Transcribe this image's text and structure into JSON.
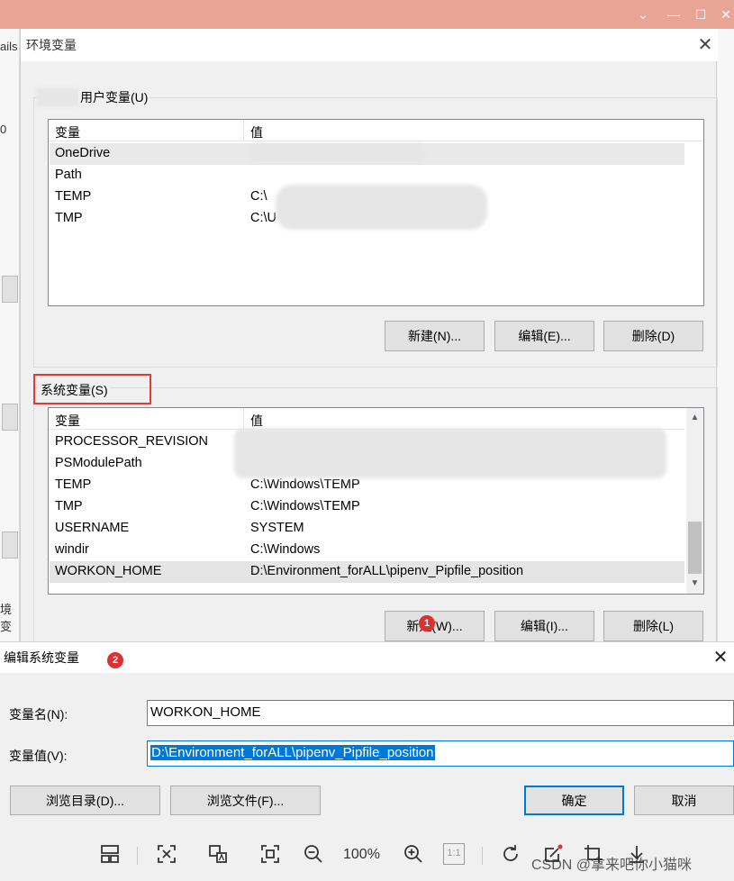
{
  "background_window": {
    "left_strip_texts": [
      "ails",
      "0",
      "境变"
    ]
  },
  "env_dialog": {
    "title": "环境变量",
    "user_group": {
      "label": "用户变量(U)",
      "headers": [
        "变量",
        "值"
      ],
      "rows": [
        {
          "name": "OneDrive",
          "value": ""
        },
        {
          "name": "Path",
          "value": ""
        },
        {
          "name": "TEMP",
          "value": "C:\\"
        },
        {
          "name": "TMP",
          "value": "C:\\U"
        }
      ],
      "buttons": [
        "新建(N)...",
        "编辑(E)...",
        "删除(D)"
      ]
    },
    "system_group": {
      "label": "系统变量(S)",
      "headers": [
        "变量",
        "值"
      ],
      "rows": [
        {
          "name": "PROCESSOR_REVISION",
          "value": ""
        },
        {
          "name": "PSModulePath",
          "value": ""
        },
        {
          "name": "TEMP",
          "value": "C:\\Windows\\TEMP"
        },
        {
          "name": "TMP",
          "value": "C:\\Windows\\TEMP"
        },
        {
          "name": "USERNAME",
          "value": "SYSTEM"
        },
        {
          "name": "windir",
          "value": "C:\\Windows"
        },
        {
          "name": "WORKON_HOME",
          "value": "D:\\Environment_forALL\\pipenv_Pipfile_position"
        }
      ],
      "buttons": [
        "新建(W)...",
        "编辑(I)...",
        "删除(L)"
      ]
    }
  },
  "edit_dialog": {
    "title": "编辑系统变量",
    "name_label": "变量名(N):",
    "name_value": "WORKON_HOME",
    "value_label": "变量值(V):",
    "value_value": "D:\\Environment_forALL\\pipenv_Pipfile_position",
    "buttons": {
      "browse_dir": "浏览目录(D)...",
      "browse_file": "浏览文件(F)...",
      "ok": "确定",
      "cancel": "取消"
    }
  },
  "annotations": {
    "badge1": "1",
    "badge2": "2"
  },
  "viewer_toolbar": {
    "zoom": "100%",
    "ratio_label": "1:1",
    "watermark": "CSDN @拿来吧你小猫咪"
  },
  "colors": {
    "titlebar": "#e8a595",
    "accent": "#0078d7",
    "highlight_box": "#e53935"
  }
}
